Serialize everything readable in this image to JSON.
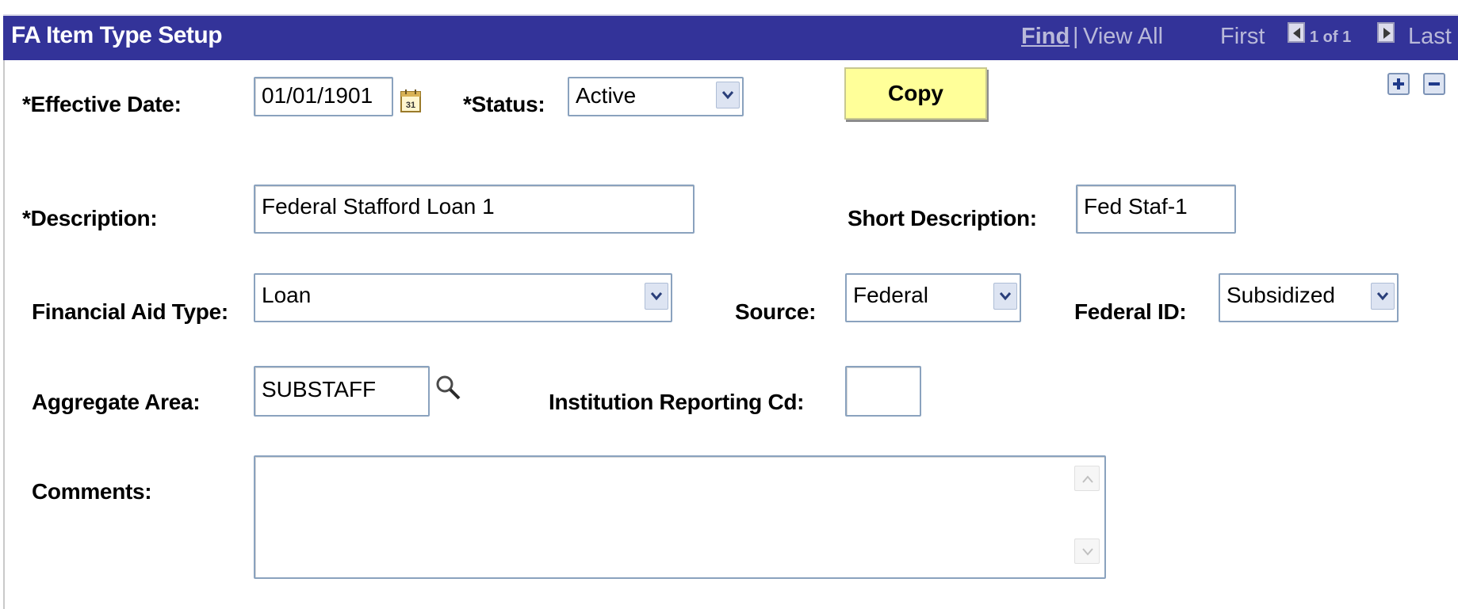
{
  "header": {
    "title": "FA Item Type Setup",
    "find": "Find",
    "separator": "|",
    "view_all": "View All",
    "first": "First",
    "record_count": "1 of 1",
    "last": "Last"
  },
  "form": {
    "effective_date": {
      "label": "*Effective Date:",
      "value": "01/01/1901"
    },
    "status": {
      "label": "*Status:",
      "value": "Active"
    },
    "copy_button": "Copy",
    "description": {
      "label": "*Description:",
      "value": "Federal Stafford Loan 1"
    },
    "short_description": {
      "label": "Short Description:",
      "value": "Fed Staf-1"
    },
    "financial_aid_type": {
      "label": "Financial Aid Type:",
      "value": "Loan"
    },
    "source": {
      "label": "Source:",
      "value": "Federal"
    },
    "federal_id": {
      "label": "Federal ID:",
      "value": "Subsidized"
    },
    "aggregate_area": {
      "label": "Aggregate Area:",
      "value": "SUBSTAFF"
    },
    "institution_reporting_cd": {
      "label": "Institution Reporting Cd:",
      "value": ""
    },
    "comments": {
      "label": "Comments:",
      "value": ""
    }
  },
  "icons": {
    "calendar": "calendar-icon",
    "lookup": "magnifier-icon",
    "add_row": "plus-icon",
    "delete_row": "minus-icon"
  },
  "colors": {
    "header_bg": "#333399",
    "copy_button_bg": "#ffff99",
    "field_border": "#8aa2be"
  }
}
